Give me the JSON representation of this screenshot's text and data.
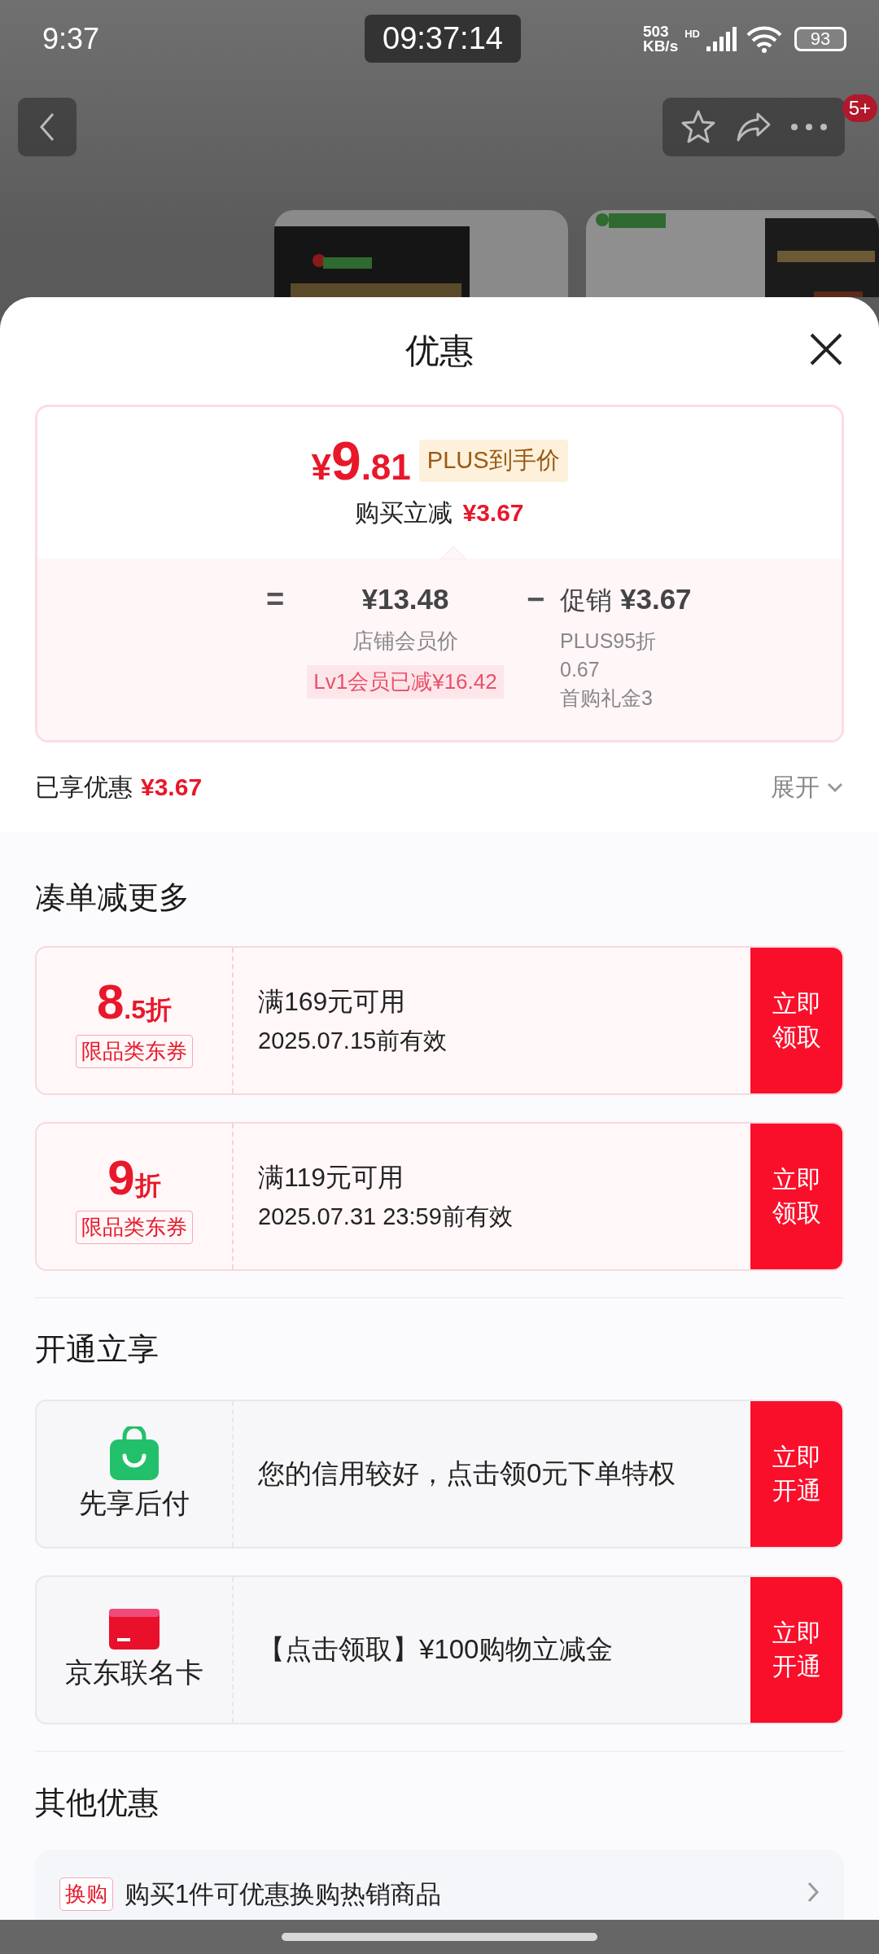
{
  "status_bar": {
    "time": "9:37",
    "clock": "09:37:14",
    "speed_value": "503",
    "speed_unit": "KB/s",
    "network_type": "HD",
    "battery": "93"
  },
  "top_nav": {
    "badge": "5+"
  },
  "sheet": {
    "title": "优惠"
  },
  "price_card": {
    "currency": "¥",
    "price_integer": "9",
    "price_decimal": ".81",
    "price_tag": "PLUS到手价",
    "cut_label": "购买立减",
    "cut_amount": "¥3.67",
    "equals": "=",
    "base_price": "¥13.48",
    "base_label": "店铺会员价",
    "member_tag": "Lv1会员已减¥16.42",
    "minus": "−",
    "promo_label": "促销",
    "promo_amount": "¥3.67",
    "promo_details": [
      "PLUS95折",
      "0.67",
      "首购礼金3"
    ]
  },
  "enjoyed": {
    "label": "已享优惠",
    "amount": "¥3.67",
    "expand": "展开"
  },
  "sections": [
    {
      "title": "凑单减更多",
      "items": [
        {
          "kind": "coupon",
          "discount_value": "8",
          "discount_unit": ".5折",
          "scope": "限品类东券",
          "condition": "满169元可用",
          "validity": "2025.07.15前有效",
          "button": "立即领取"
        },
        {
          "kind": "coupon",
          "discount_value": "9",
          "discount_unit": "折",
          "scope": "限品类东券",
          "condition": "满119元可用",
          "validity": "2025.07.31 23:59前有效",
          "button": "立即领取"
        }
      ]
    },
    {
      "title": "开通立享",
      "items": [
        {
          "kind": "service",
          "name": "先享后付",
          "description": "您的信用较好，点击领0元下单特权",
          "button": "立即开通"
        },
        {
          "kind": "service",
          "name": "京东联名卡",
          "description": "【点击领取】¥100购物立减金",
          "button": "立即开通"
        }
      ]
    },
    {
      "title": "其他优惠",
      "items": [
        {
          "kind": "offer",
          "tag": "换购",
          "text": "购买1件可优惠换购热销商品"
        }
      ]
    }
  ]
}
